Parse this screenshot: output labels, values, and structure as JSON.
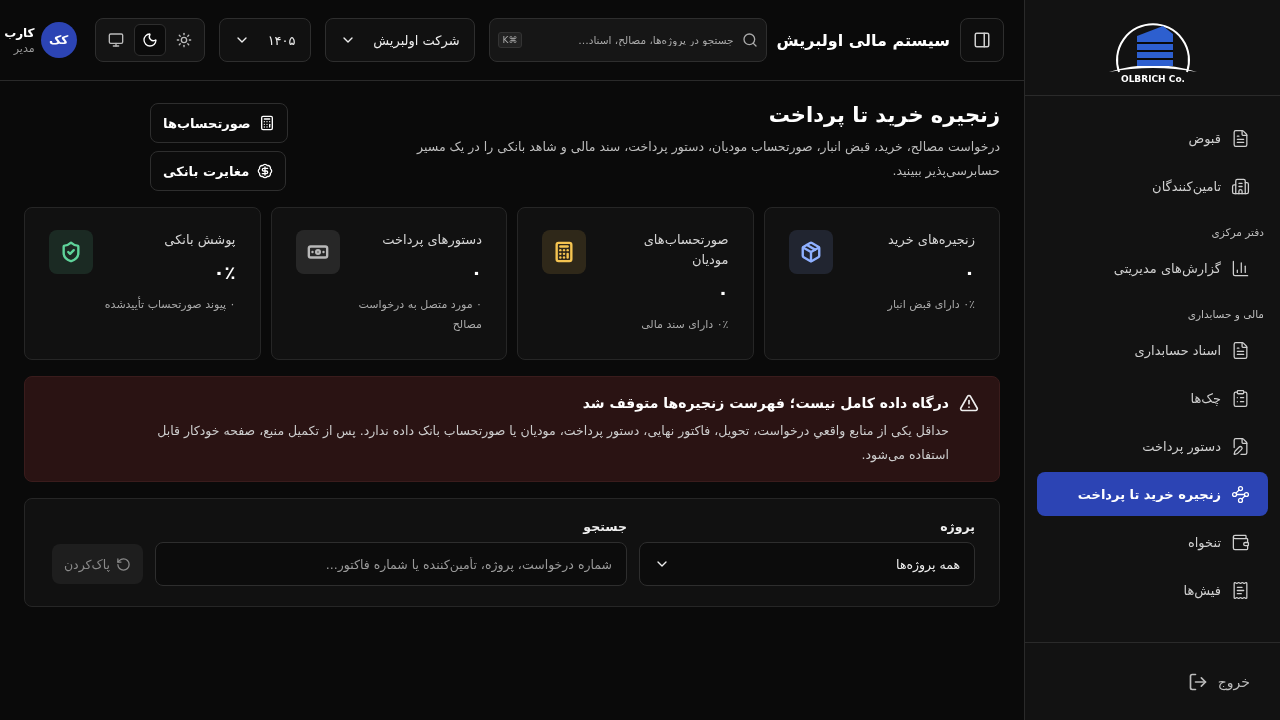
{
  "sidebar": {
    "logo_text": "OLBRICH Co.",
    "items": [
      {
        "kind": "item",
        "label": "قبوض",
        "selected": false
      },
      {
        "kind": "item",
        "label": "تامین‌کنندگان",
        "selected": false
      },
      {
        "kind": "heading",
        "label": "دفتر مرکزی"
      },
      {
        "kind": "item",
        "label": "گزارش‌های مدیریتی",
        "selected": false
      },
      {
        "kind": "heading",
        "label": "مالی و حسابداری"
      },
      {
        "kind": "item",
        "label": "اسناد حسابداری",
        "selected": false
      },
      {
        "kind": "item",
        "label": "چک‌ها",
        "selected": false
      },
      {
        "kind": "item",
        "label": "دستور پرداخت",
        "selected": false
      },
      {
        "kind": "item",
        "label": "زنجیره خرید تا پرداخت",
        "selected": true
      },
      {
        "kind": "item",
        "label": "تنخواه",
        "selected": false
      },
      {
        "kind": "item",
        "label": "فیش‌ها",
        "selected": false
      }
    ],
    "logout": "خروج"
  },
  "header": {
    "title": "سیستم مالی اولبریش",
    "search": {
      "placeholder": "جستجو در پروژه‌ها، مصالح، اسناد…",
      "shortcut": "K⌘"
    },
    "company": "شرکت اولبریش",
    "year": "۱۴۰۵",
    "theme_options": [
      {
        "selected": false
      },
      {
        "selected": true
      },
      {
        "selected": false
      }
    ],
    "user": {
      "initials": "کک",
      "name": "کارب",
      "role": "مدیر"
    }
  },
  "page": {
    "title": "زنجیره خرید تا پرداخت",
    "description": "درخواست مصالح، خرید، قبض انبار، صورتحساب مودیان، دستور پرداخت، سند مالی و شاهد بانکی را در یک مسیر حسابرسی‌پذیر ببینید.",
    "actions": [
      "صورتحساب‌ها",
      "مغایرت بانکی"
    ]
  },
  "stats": [
    {
      "title": "زنجیره‌های خرید",
      "value": "۰",
      "note": "۰٪ دارای قبض انبار",
      "color": "#8fb0ff"
    },
    {
      "title": "صورتحساب‌های مودیان",
      "value": "۰",
      "note": "۰٪ دارای سند مالی",
      "color": "#f5c451"
    },
    {
      "title": "دستورهای پرداخت",
      "value": "۰",
      "note": "۰ مورد متصل به درخواست مصالح",
      "color": "#b8b8b8"
    },
    {
      "title": "پوشش بانکی",
      "value": "۰٪",
      "note": "۰ پیوند صورتحساب تأییدشده",
      "color": "#5fd39a"
    }
  ],
  "alert": {
    "title": "درگاه داده کامل نیست؛ فهرست زنجیره‌ها متوقف شد",
    "body": "حداقل یکی از منابع واقعیِ درخواست، تحویل، فاکتور نهایی، دستور پرداخت، مودیان یا صورتحساب بانک داده ندارد. پس از تکمیل منبع، صفحه خودکار قابل استفاده می‌شود."
  },
  "filters": {
    "project_label": "پروژه",
    "project_value": "همه پروژه‌ها",
    "search_label": "جستجو",
    "search_placeholder": "شماره درخواست، پروژه، تأمین‌کننده یا شماره فاکتور...",
    "clear": "پاک‌کردن"
  }
}
